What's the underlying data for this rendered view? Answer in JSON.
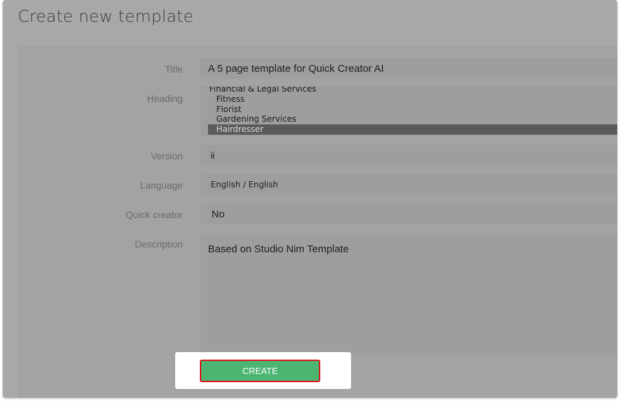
{
  "dialog": {
    "title": "Create new template"
  },
  "form": {
    "title": {
      "label": "Title",
      "value": "A 5 page template for Quick Creator AI"
    },
    "heading": {
      "label": "Heading",
      "options": [
        {
          "text": "Financial & Legal Services",
          "group": true,
          "selected": false
        },
        {
          "text": "Fitness",
          "group": false,
          "selected": false
        },
        {
          "text": "Florist",
          "group": false,
          "selected": false
        },
        {
          "text": "Gardening Services",
          "group": false,
          "selected": false
        },
        {
          "text": "Hairdresser",
          "group": false,
          "selected": true
        }
      ]
    },
    "version": {
      "label": "Version",
      "value": "ii"
    },
    "language": {
      "label": "Language",
      "value": "English / English"
    },
    "quick_creator": {
      "label": "Quick creator",
      "value": "No"
    },
    "description": {
      "label": "Description",
      "value": "Based on Studio Nim Template"
    }
  },
  "actions": {
    "create_label": "CREATE"
  },
  "colors": {
    "dialog_bg": "#a8a8a8",
    "field_bg": "#9e9e9e",
    "selected_option_bg": "#5a5a5a",
    "create_button_bg": "#4cb572",
    "highlight_border": "#e0141e"
  }
}
